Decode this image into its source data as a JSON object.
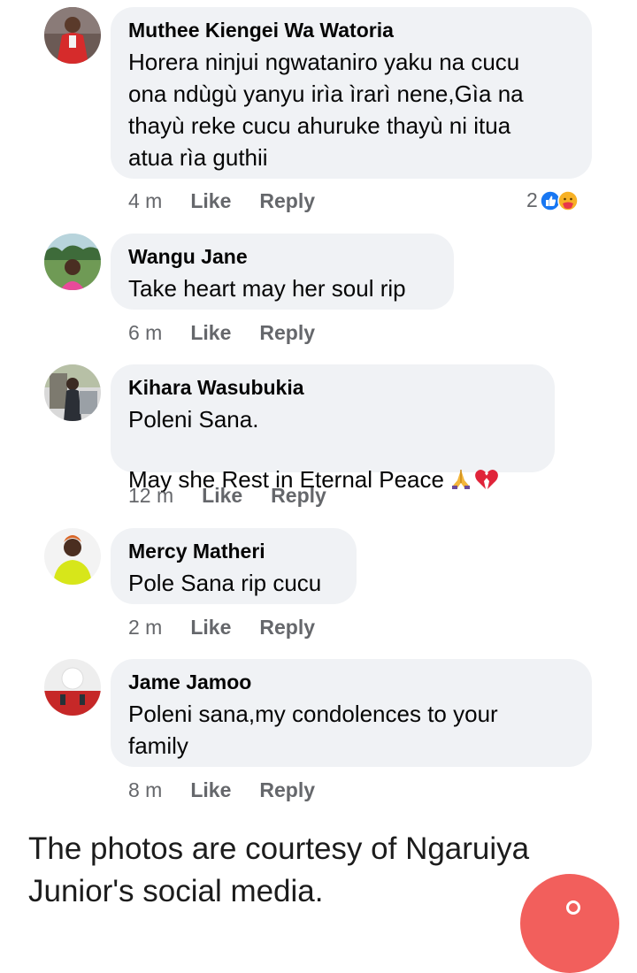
{
  "comments": [
    {
      "name": "Muthee Kiengei Wa Watoria",
      "text": "Horera ninjui ngwataniro yaku na cucu\nona ndùgù yanyu irìa ìrarì nene,Gìa na\nthayù reke cucu ahuruke thayù ni itua\natua rìa guthii",
      "time": "4 m",
      "like": "Like",
      "reply": "Reply",
      "reaction_count": "2",
      "reactions": [
        "like-reaction-icon",
        "care-reaction-icon"
      ]
    },
    {
      "name": "Wangu Jane",
      "text": "Take heart may her soul rip",
      "time": "6 m",
      "like": "Like",
      "reply": "Reply"
    },
    {
      "name": "Kihara Wasubukia",
      "text": "Poleni Sana.\nMay she Rest in Eternal Peace",
      "emoji": [
        "folded-hands-icon",
        "broken-heart-icon"
      ],
      "time": "12 m",
      "like": "Like",
      "reply": "Reply"
    },
    {
      "name": "Mercy Matheri",
      "text": "Pole Sana rip cucu",
      "time": "2 m",
      "like": "Like",
      "reply": "Reply"
    },
    {
      "name": "Jame Jamoo",
      "text": "Poleni sana,my condolences to your\nfamily",
      "time": "8 m",
      "like": "Like",
      "reply": "Reply"
    }
  ],
  "caption": "The photos are courtesy of Ngaruiya Junior's social media.",
  "colors": {
    "bubble": "#f0f2f5",
    "meta": "#65676b",
    "like_blue": "#1877f2",
    "fab": "#f25f5c"
  }
}
